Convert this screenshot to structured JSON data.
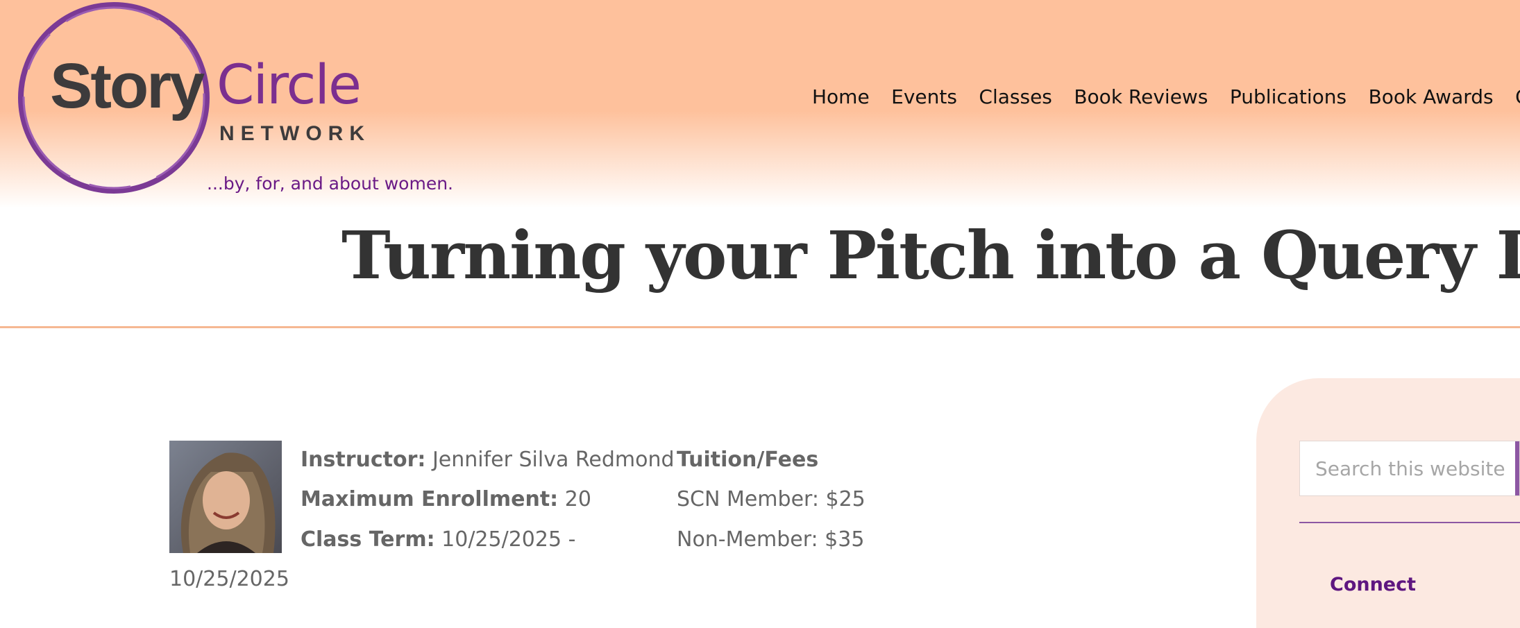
{
  "logo": {
    "word1": "Story",
    "word2": "Circle",
    "word3": "NETWORK",
    "tagline": "...by, for, and about women."
  },
  "nav": {
    "items": [
      "Home",
      "Events",
      "Classes",
      "Book Reviews",
      "Publications",
      "Book Awards",
      "C"
    ]
  },
  "page": {
    "title": "Turning your Pitch into a Query Letter"
  },
  "class_info": {
    "instructor_label": "Instructor:",
    "instructor_value": "Jennifer Silva Redmond",
    "enrollment_label": "Maximum Enrollment:",
    "enrollment_value": "20",
    "term_label": "Class Term:",
    "term_value_start": "10/25/2025 -",
    "term_value_end": "10/25/2025"
  },
  "fees": {
    "heading": "Tuition/Fees",
    "member": "SCN Member: $25",
    "non_member": "Non-Member: $35"
  },
  "sidebar": {
    "search_placeholder": "Search this website",
    "connect": "Connect"
  },
  "colors": {
    "header_peach": "#fec19c",
    "brand_purple": "#7b2f8f",
    "rule": "#f6b892",
    "sidebar_bg": "#fce9e1"
  }
}
